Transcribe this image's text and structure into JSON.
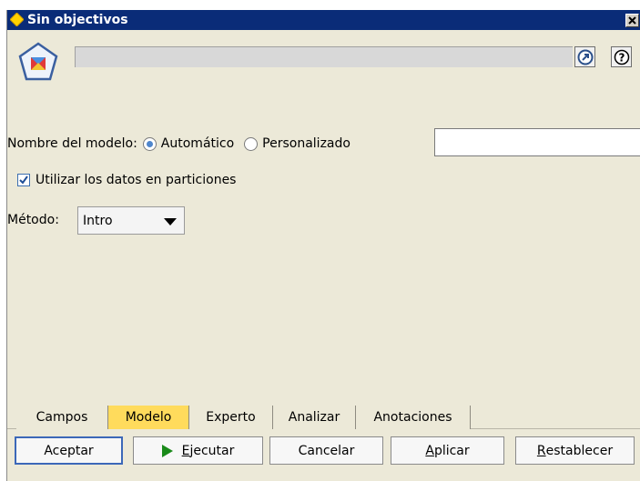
{
  "window": {
    "title": "Sin objectivos"
  },
  "header": {
    "node_name": "",
    "expand_button": "expand-icon",
    "help_button": "help-icon"
  },
  "form": {
    "model_name_label": "Nombre del modelo:",
    "radio_auto_label": "Automático",
    "radio_custom_label": "Personalizado",
    "model_name_selected": "Automático",
    "custom_name_value": "",
    "use_partitions_label": "Utilizar los datos en particiones",
    "use_partitions_checked": true,
    "method_label": "Método:",
    "method_value": "Intro"
  },
  "tabs": [
    {
      "label": "Campos",
      "active": false
    },
    {
      "label": "Modelo",
      "active": true
    },
    {
      "label": "Experto",
      "active": false
    },
    {
      "label": "Analizar",
      "active": false
    },
    {
      "label": "Anotaciones",
      "active": false
    }
  ],
  "buttons": {
    "ok": "Aceptar",
    "run_first": "E",
    "run_rest": "jecutar",
    "cancel": "Cancelar",
    "apply_first": "A",
    "apply_rest": "plicar",
    "reset_first": "R",
    "reset_rest": "establecer"
  },
  "colors": {
    "titlebar": "#0a2c78",
    "active_tab": "#ffdb5c",
    "window_bg": "#ece9d8",
    "run_icon": "#1a8a1a"
  }
}
